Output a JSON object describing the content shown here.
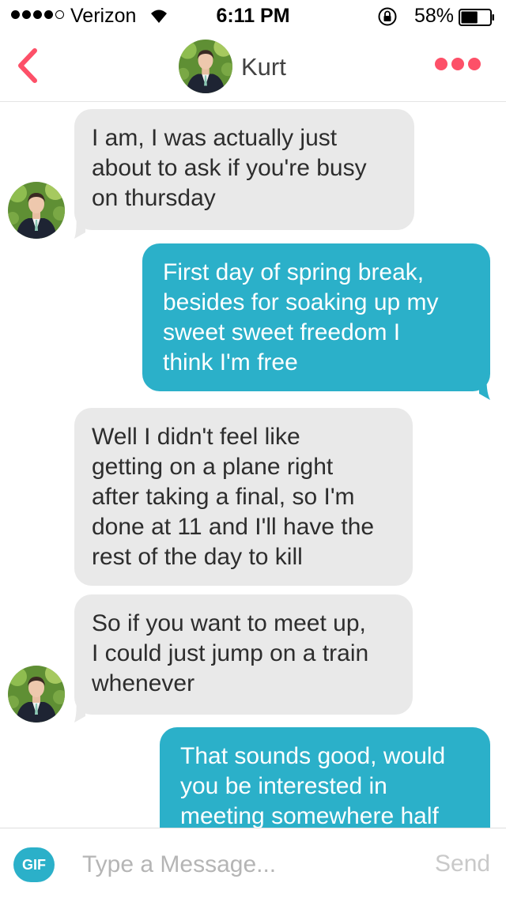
{
  "status_bar": {
    "carrier": "Verizon",
    "signal_bars_filled": 4,
    "signal_bars_total": 5,
    "time": "6:11 PM",
    "battery_percent": "58%",
    "battery_level": 0.58
  },
  "header": {
    "contact_name": "Kurt",
    "back_icon": "chevron-left-icon",
    "more_icon": "more-dots-icon"
  },
  "messages": [
    {
      "from": "them",
      "text_lines": [
        "I am, I was actually just",
        "about to ask if you're busy",
        "on thursday"
      ]
    },
    {
      "from": "me",
      "text_lines": [
        "First day of spring break,",
        "besides for soaking up  my",
        "sweet sweet freedom I",
        "think I'm free"
      ]
    },
    {
      "from": "them",
      "text_lines": [
        "Well I didn't feel like",
        "getting on a plane right",
        "after taking a final, so I'm",
        "done at 11 and I'll have the",
        "rest of the day to kill"
      ]
    },
    {
      "from": "them",
      "text_lines": [
        "So if you want to meet up,",
        "I could just jump on a train",
        "whenever"
      ]
    },
    {
      "from": "me",
      "text_lines": [
        "That sounds good, would",
        "you be interested in",
        "meeting somewhere half"
      ]
    }
  ],
  "composer": {
    "gif_label": "GIF",
    "placeholder": "Type a Message...",
    "send_label": "Send"
  },
  "colors": {
    "accent_red": "#fd5068",
    "outgoing_bubble": "#2bb0c9",
    "incoming_bubble": "#e9e9e9"
  }
}
